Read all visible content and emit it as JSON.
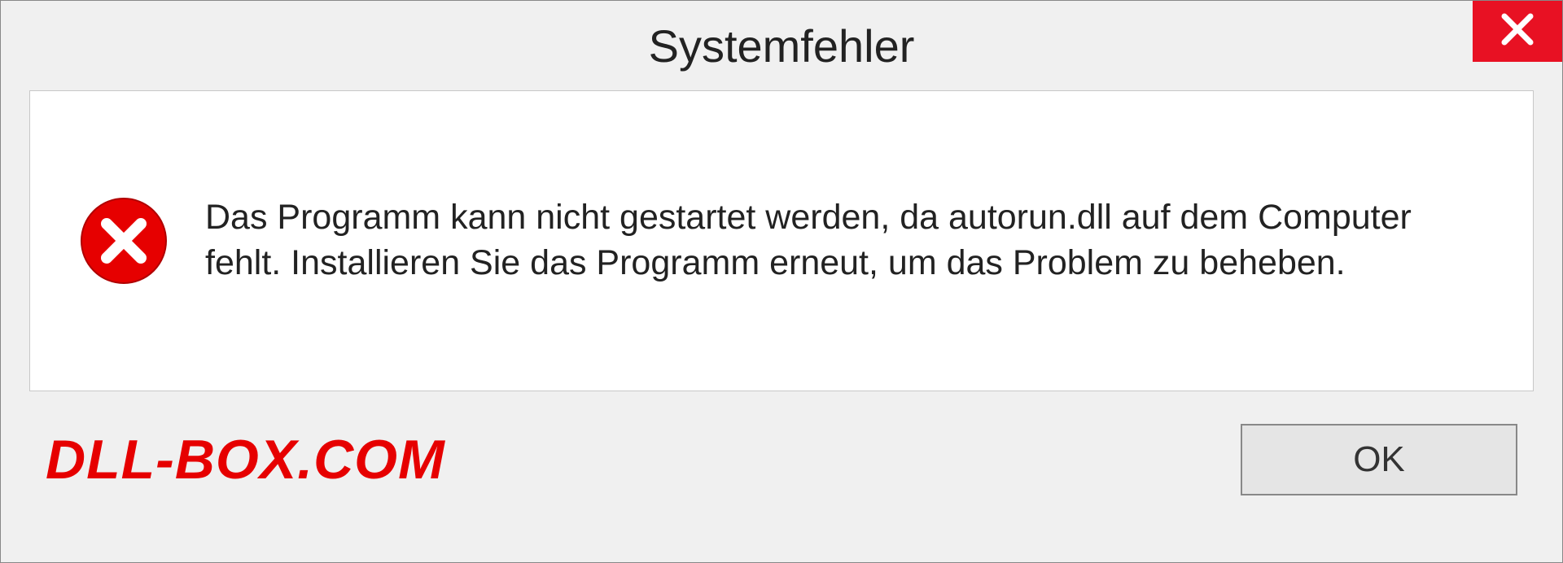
{
  "dialog": {
    "title": "Systemfehler",
    "message": "Das Programm kann nicht gestartet werden, da autorun.dll auf dem Computer fehlt. Installieren Sie das Programm erneut, um das Problem zu beheben.",
    "ok_label": "OK"
  },
  "watermark": "DLL-BOX.COM"
}
